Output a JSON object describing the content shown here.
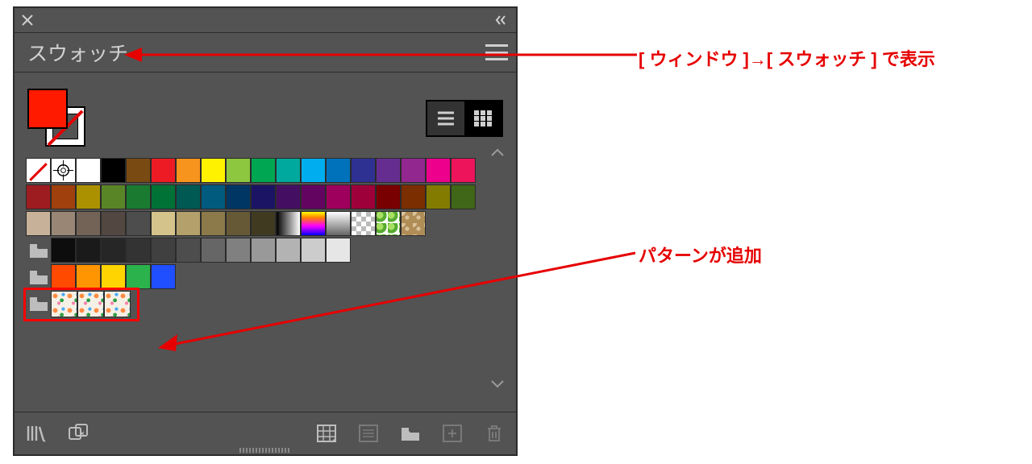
{
  "panel": {
    "title": "スウォッチ",
    "fill_color": "#ff1a00",
    "stroke_state": "none",
    "view": "grid"
  },
  "swatch_rows": {
    "row1": [
      "none",
      "registration",
      "#ffffff",
      "#000000",
      "#7a4a13",
      "#ed1c24",
      "#f7941d",
      "#fff200",
      "#8dc63f",
      "#00a651",
      "#00a99d",
      "#00aeef",
      "#0072bc",
      "#2e3192",
      "#662d91",
      "#92278f",
      "#ec008c",
      "#ed145b"
    ],
    "row2": [
      "#9d1c20",
      "#a0410d",
      "#ab9100",
      "#598527",
      "#1a7b30",
      "#007236",
      "#005952",
      "#005b7f",
      "#003663",
      "#1b1464",
      "#440e62",
      "#630460",
      "#9e005d",
      "#9e0039",
      "#790000",
      "#7b2e00",
      "#827b00",
      "#406618"
    ],
    "row3_base": [
      "#c7b299",
      "#998675",
      "#736357",
      "#534741",
      "#4d4d4d",
      "#d4c38a",
      "#b3a06b",
      "#8c7a4a",
      "#665936",
      "#403a21"
    ],
    "row3_special": [
      "grad-bw",
      "grad-rainbow",
      "grad-fade",
      "checker",
      "leaf",
      "scroll"
    ],
    "grays": [
      "#0d0d0d",
      "#1a1a1a",
      "#262626",
      "#333333",
      "#404040",
      "#4d4d4d",
      "#666666",
      "#808080",
      "#999999",
      "#b3b3b3",
      "#cccccc",
      "#e6e6e6"
    ],
    "brights": [
      "#ff4a00",
      "#ff9500",
      "#ffd400",
      "#2bb24c",
      "#1f4fff"
    ]
  },
  "patterns": {
    "count": 3,
    "label": "floral-pattern"
  },
  "footer_icons": [
    "library",
    "swap",
    "grid-options",
    "list-view",
    "folder-new",
    "new-swatch",
    "trash"
  ],
  "callouts": {
    "top": "[ ウィンドウ ]→[ スウォッチ ] で表示",
    "mid": "パターンが追加"
  }
}
